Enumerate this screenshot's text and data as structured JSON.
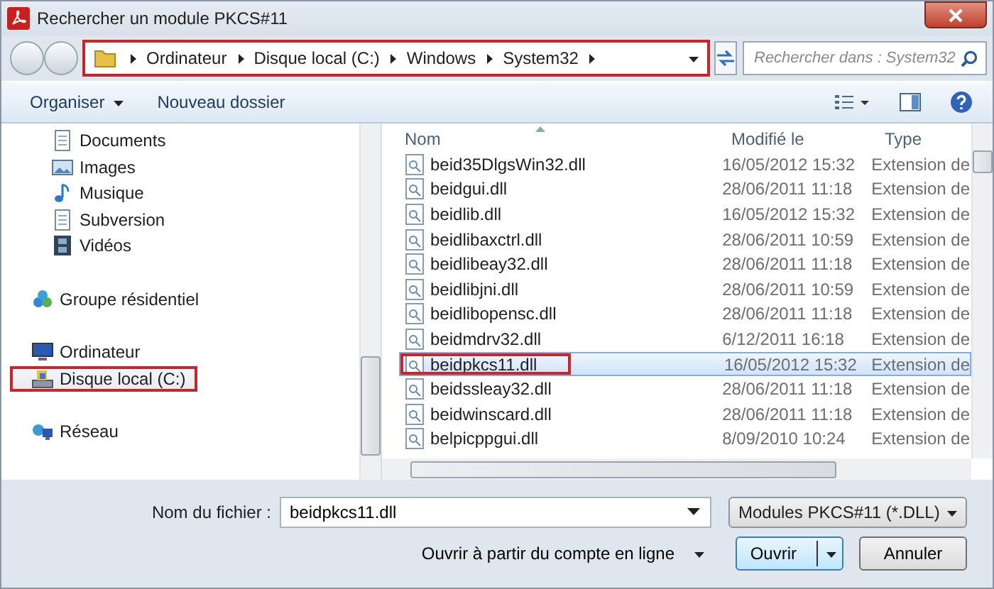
{
  "window": {
    "title": "Rechercher un module PKCS#11"
  },
  "address_bar": {
    "marked": true,
    "segments": [
      "Ordinateur",
      "Disque local (C:)",
      "Windows",
      "System32"
    ]
  },
  "search": {
    "placeholder": "Rechercher dans : System32"
  },
  "toolbar": {
    "buttons": [
      {
        "label": "Organiser",
        "dropdown": true
      },
      {
        "label": "Nouveau dossier",
        "dropdown": false
      }
    ]
  },
  "sidebar": {
    "sections": [
      {
        "items": [
          {
            "label": "Documents",
            "kind": "document",
            "selected": false,
            "marked": false
          },
          {
            "label": "Images",
            "kind": "pictures",
            "selected": false,
            "marked": false
          },
          {
            "label": "Musique",
            "kind": "music",
            "selected": false,
            "marked": false
          },
          {
            "label": "Subversion",
            "kind": "document",
            "selected": false,
            "marked": false
          },
          {
            "label": "Vidéos",
            "kind": "video",
            "selected": false,
            "marked": false
          }
        ],
        "indent": true
      },
      {
        "items": [
          {
            "label": "Groupe résidentiel",
            "kind": "homegroup",
            "selected": false,
            "marked": false
          }
        ]
      },
      {
        "items": [
          {
            "label": "Ordinateur",
            "kind": "computer",
            "selected": false,
            "marked": false,
            "children": [
              {
                "label": "Disque local (C:)",
                "kind": "drive",
                "selected": true,
                "marked": true
              }
            ]
          }
        ]
      },
      {
        "items": [
          {
            "label": "Réseau",
            "kind": "network",
            "selected": false,
            "marked": false
          }
        ]
      }
    ]
  },
  "table": {
    "columns": [
      "Nom",
      "Modifié le",
      "Type"
    ],
    "rows": [
      {
        "name": "beid35DlgsWin32.dll",
        "modified": "16/05/2012 15:32",
        "type": "Extension de",
        "selected": false,
        "marked": false
      },
      {
        "name": "beidgui.dll",
        "modified": "28/06/2011 11:18",
        "type": "Extension de",
        "selected": false,
        "marked": false
      },
      {
        "name": "beidlib.dll",
        "modified": "16/05/2012 15:32",
        "type": "Extension de",
        "selected": false,
        "marked": false
      },
      {
        "name": "beidlibaxctrl.dll",
        "modified": "28/06/2011 10:59",
        "type": "Extension de",
        "selected": false,
        "marked": false
      },
      {
        "name": "beidlibeay32.dll",
        "modified": "28/06/2011 11:18",
        "type": "Extension de",
        "selected": false,
        "marked": false
      },
      {
        "name": "beidlibjni.dll",
        "modified": "28/06/2011 10:59",
        "type": "Extension de",
        "selected": false,
        "marked": false
      },
      {
        "name": "beidlibopensc.dll",
        "modified": "28/06/2011 11:18",
        "type": "Extension de",
        "selected": false,
        "marked": false
      },
      {
        "name": "beidmdrv32.dll",
        "modified": "6/12/2011 16:18",
        "type": "Extension de",
        "selected": false,
        "marked": false
      },
      {
        "name": "beidpkcs11.dll",
        "modified": "16/05/2012 15:32",
        "type": "Extension de",
        "selected": true,
        "marked": true
      },
      {
        "name": "beidssleay32.dll",
        "modified": "28/06/2011 11:18",
        "type": "Extension de",
        "selected": false,
        "marked": false
      },
      {
        "name": "beidwinscard.dll",
        "modified": "28/06/2011 11:18",
        "type": "Extension de",
        "selected": false,
        "marked": false
      },
      {
        "name": "belpicppgui.dll",
        "modified": "8/09/2010 10:24",
        "type": "Extension de",
        "selected": false,
        "marked": false
      }
    ]
  },
  "footer": {
    "filename_label": "Nom du fichier :",
    "filename": "beidpkcs11.dll",
    "filter": "Modules PKCS#11 (*.DLL)",
    "online_link": "Ouvrir à partir du compte en ligne",
    "buttons": [
      {
        "label": "Ouvrir",
        "kind": "split"
      },
      {
        "label": "Annuler",
        "kind": "plain"
      }
    ]
  }
}
